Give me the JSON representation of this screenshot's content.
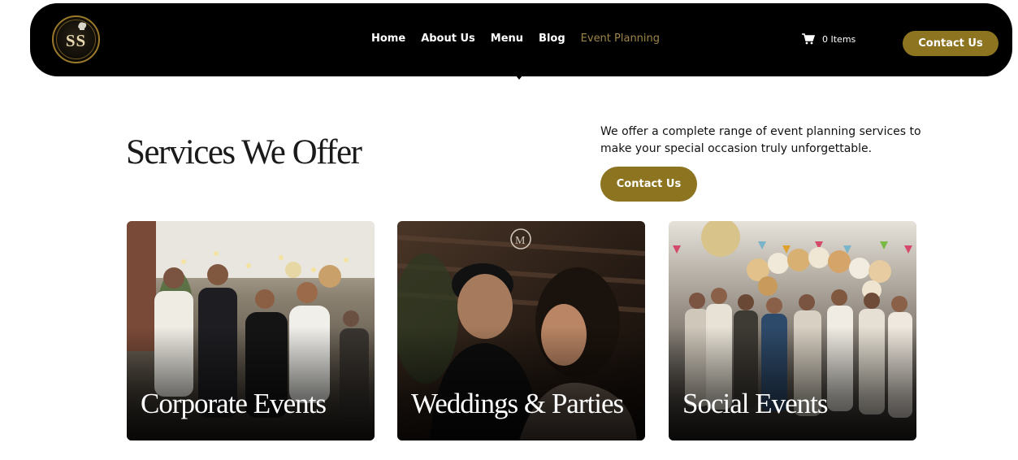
{
  "brand": {
    "logo_text": "SS",
    "logo_icon": "chef-hat-logo"
  },
  "nav": {
    "links": [
      "Home",
      "About Us",
      "Menu",
      "Blog",
      "Event Planning"
    ],
    "active_index": 4,
    "cart_count": "0 Items",
    "cart_icon": "shopping-cart-icon",
    "contact_label": "Contact Us"
  },
  "hero": {
    "title": "Services We Offer",
    "description": "We offer a complete range of event planning services to make your special occasion truly unforgettable.",
    "contact_label": "Contact Us"
  },
  "cards": [
    {
      "title": "Corporate Events"
    },
    {
      "title": "Weddings & Parties"
    },
    {
      "title": "Social Events"
    }
  ],
  "colors": {
    "nav_bg": "#000000",
    "accent_gold": "#8c7420",
    "active_link": "#9e8648",
    "text": "#111111"
  }
}
